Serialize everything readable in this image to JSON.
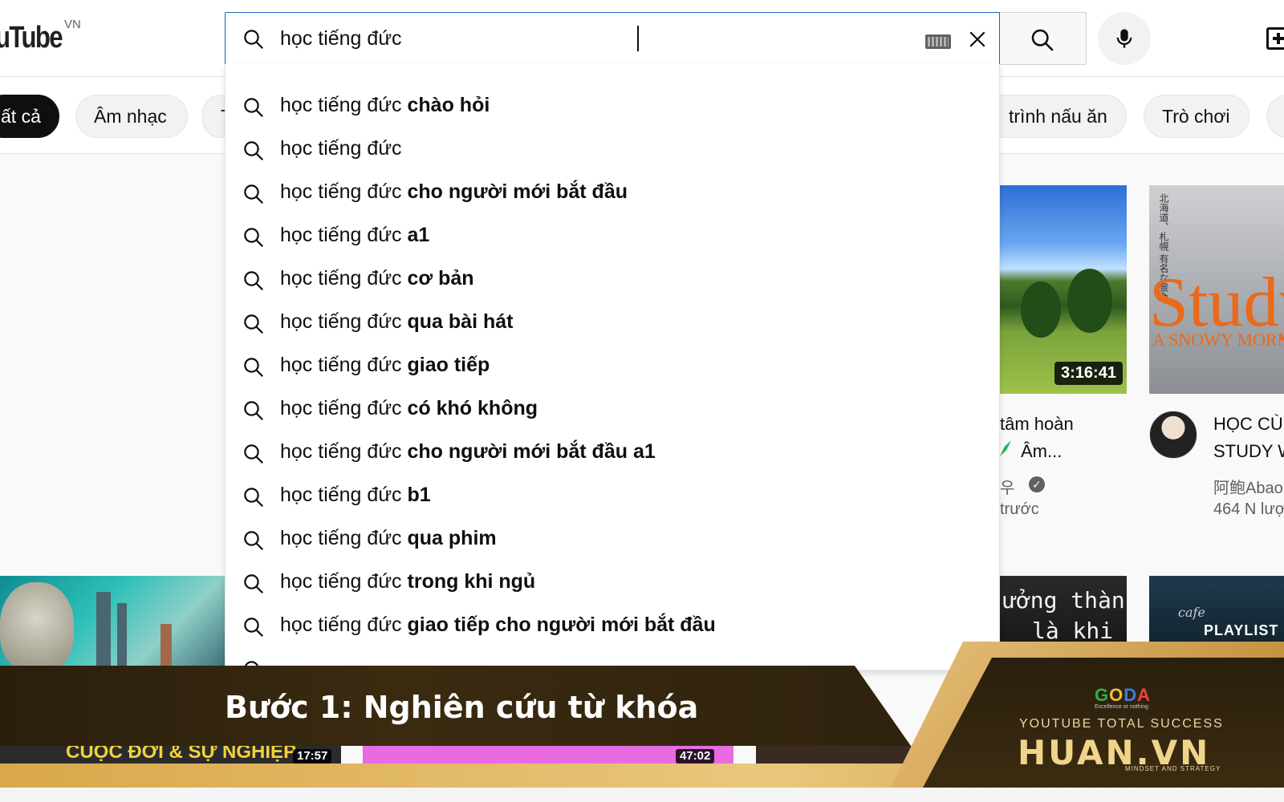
{
  "header": {
    "logo_text": "uTube",
    "region": "VN",
    "search": {
      "value": "học tiếng đức"
    }
  },
  "chips": [
    {
      "label": "ất cả",
      "active": true
    },
    {
      "label": "Âm nhạc",
      "active": false
    },
    {
      "label": "T",
      "active": false
    },
    {
      "label": "trình nấu ăn",
      "active": false
    },
    {
      "label": "Trò chơi",
      "active": false
    }
  ],
  "suggestions": [
    {
      "prefix": "học tiếng đức",
      "suffix": " chào hỏi"
    },
    {
      "prefix": "học tiếng đức",
      "suffix": ""
    },
    {
      "prefix": "học tiếng đức",
      "suffix": " cho người mới bắt đầu"
    },
    {
      "prefix": "học tiếng đức",
      "suffix": " a1"
    },
    {
      "prefix": "học tiếng đức",
      "suffix": " cơ bản"
    },
    {
      "prefix": "học tiếng đức",
      "suffix": " qua bài hát"
    },
    {
      "prefix": "học tiếng đức",
      "suffix": " giao tiếp"
    },
    {
      "prefix": "học tiếng đức",
      "suffix": " có khó không"
    },
    {
      "prefix": "học tiếng đức",
      "suffix": " cho người mới bắt đầu a1"
    },
    {
      "prefix": "học tiếng đức",
      "suffix": " b1"
    },
    {
      "prefix": "học tiếng đức",
      "suffix": " qua phim"
    },
    {
      "prefix": "học tiếng đức",
      "suffix": " trong khi ngủ"
    },
    {
      "prefix": "học tiếng đức",
      "suffix": " giao tiếp cho người mới bắt đầu"
    }
  ],
  "videos": {
    "v1": {
      "duration": "3:16:41",
      "title_line1": "tâm hoàn",
      "title_line2": "Âm...",
      "channel": "우",
      "age": "trước"
    },
    "v2": {
      "thumb_big": "Study",
      "thumb_small": "A SNOWY MORN",
      "title_line1": "HỌC CÙ",
      "title_line2": "STUDY W",
      "channel": "阿鲍Abao",
      "views": "464 N lượ"
    },
    "v3": {
      "thumb_line1": "ưởng thành",
      "thumb_line2": "là khi"
    },
    "v4": {
      "playlist": "PLAYLIST",
      "script": "cafe"
    }
  },
  "strip": {
    "text1": "CUỘC ĐỜI & SỰ NGHIỆP",
    "dur1": "17:57",
    "dur2": "47:02"
  },
  "banner": {
    "title": "Bước 1: Nghiên cứu từ khóa",
    "brand_small": "GODA",
    "brand_tagline": "Excellence or nothing",
    "tagline": "YOUTUBE TOTAL SUCCESS",
    "brand": "HUAN.VN",
    "sub": "MINDSET AND STRATEGY"
  },
  "colors": {
    "accent_blue": "#1c62b9",
    "banner_dark": "#2a1f0d",
    "banner_gold": "#d9a84a"
  }
}
